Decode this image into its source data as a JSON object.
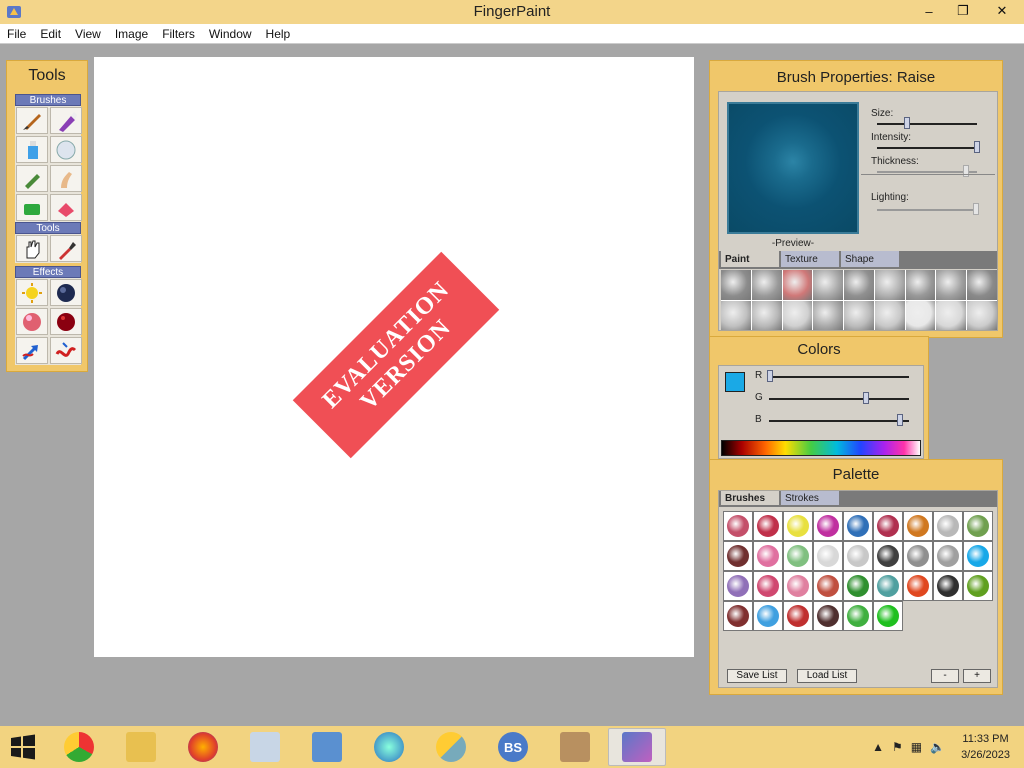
{
  "window": {
    "title": "FingerPaint",
    "app_icon": "fingerpaint-icon",
    "minimize_label": "–",
    "maximize_label": "❐",
    "close_label": "✕"
  },
  "menu": [
    "File",
    "Edit",
    "View",
    "Image",
    "Filters",
    "Window",
    "Help"
  ],
  "canvas": {
    "watermark_line1": "EVALUATION",
    "watermark_line2": "VERSION"
  },
  "tools_panel": {
    "title": "Tools",
    "sections": {
      "brushes": "Brushes",
      "tools": "Tools",
      "effects": "Effects"
    },
    "brush_icons": [
      "paint-brush-icon",
      "marker-icon",
      "glue-bottle-icon",
      "bubble-icon",
      "crayon-icon",
      "finger-icon",
      "sponge-icon",
      "eraser-icon"
    ],
    "tool_icons": [
      "hand-icon",
      "eyedropper-icon"
    ],
    "effect_icons": [
      "sun-icon",
      "moon-icon",
      "sphere-icon",
      "dark-sphere-icon",
      "arrow-icon",
      "wave-icon"
    ]
  },
  "brush_properties": {
    "title": "Brush Properties: Raise",
    "preview_label": "-Preview-",
    "size_label": "Size:",
    "intensity_label": "Intensity:",
    "thickness_label": "Thickness:",
    "lighting_label": "Lighting:",
    "tabs": [
      "Paint",
      "Texture",
      "Shape"
    ],
    "active_tab": "Paint"
  },
  "colors_panel": {
    "title": "Colors",
    "current_color": "#1aa9e6",
    "r_label": "R",
    "g_label": "G",
    "b_label": "B"
  },
  "palette_panel": {
    "title": "Palette",
    "tabs": [
      "Brushes",
      "Strokes"
    ],
    "active_tab": "Brushes",
    "brush_colors": [
      "#c4506a",
      "#c0304a",
      "#e8e040",
      "#c030a0",
      "#3070b8",
      "#b03050",
      "#d07820",
      "#b8b8b8",
      "#70a050",
      "#703030",
      "#e070a0",
      "#80c080",
      "#d8d8d8",
      "#c8c8c8",
      "#404040",
      "#909090",
      "#a0a0a0",
      "#18a8e8",
      "#9070b8",
      "#d04870",
      "#e080a0",
      "#c05040",
      "#309030",
      "#50a0a0",
      "#e04820",
      "#303030",
      "#60a020",
      "#803030",
      "#40a0e0",
      "#c03030",
      "#503030",
      "#40b040",
      "#20c020"
    ],
    "save_list": "Save List",
    "load_list": "Load List",
    "minus": "-",
    "plus": "+"
  },
  "taskbar": {
    "items": [
      "chrome-icon",
      "file-explorer-icon",
      "firefox-icon",
      "monitor-app-icon",
      "control-panel-icon",
      "internet-explorer-icon",
      "weather-app-icon",
      "bs-app-icon",
      "archive-app-icon",
      "fingerpaint-taskbar-icon"
    ],
    "time": "11:33 PM",
    "date": "3/26/2023"
  }
}
